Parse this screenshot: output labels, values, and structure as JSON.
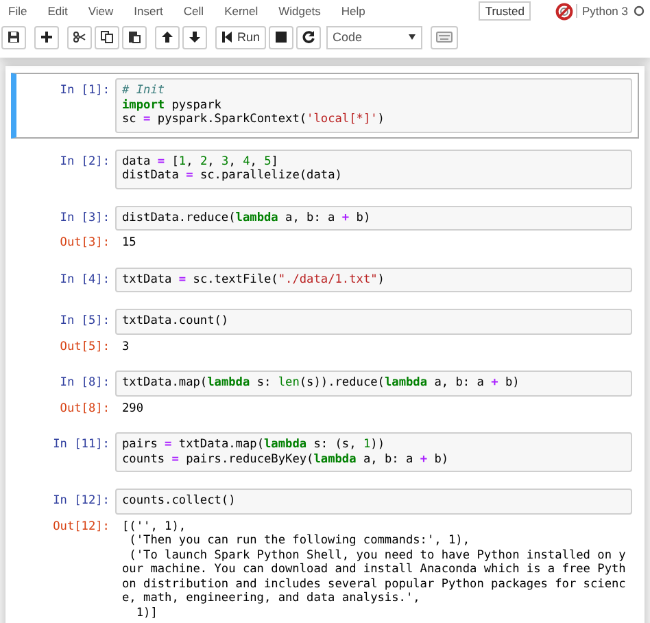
{
  "menu": [
    "File",
    "Edit",
    "View",
    "Insert",
    "Cell",
    "Kernel",
    "Widgets",
    "Help"
  ],
  "trusted": "Trusted",
  "kernel_name": "Python 3",
  "toolbar": [
    {
      "kind": "save"
    },
    {
      "kind": "sep"
    },
    {
      "kind": "add"
    },
    {
      "kind": "sep"
    },
    {
      "kind": "cut"
    },
    {
      "kind": "copy"
    },
    {
      "kind": "paste"
    },
    {
      "kind": "sep"
    },
    {
      "kind": "up"
    },
    {
      "kind": "down"
    },
    {
      "kind": "sep"
    },
    {
      "kind": "run",
      "label": "Run"
    },
    {
      "kind": "stop"
    },
    {
      "kind": "restart"
    },
    {
      "kind": "select",
      "label": "Code"
    },
    {
      "kind": "sep"
    },
    {
      "kind": "keyboard"
    }
  ],
  "cells": [
    {
      "prompt": "In [1]:",
      "selected": true,
      "lines": [
        [
          {
            "kind": "comment",
            "text": "# Init"
          }
        ],
        [
          {
            "kind": "keyword",
            "text": "import"
          },
          {
            "kind": "plain",
            "text": " pyspark"
          }
        ],
        [
          {
            "kind": "plain",
            "text": "sc "
          },
          {
            "kind": "operator",
            "text": "="
          },
          {
            "kind": "plain",
            "text": " pyspark.SparkContext("
          },
          {
            "kind": "string",
            "text": "'local[*]'"
          },
          {
            "kind": "plain",
            "text": ")"
          }
        ]
      ]
    },
    {
      "prompt": "In [2]:",
      "selected": false,
      "lines": [
        [
          {
            "kind": "plain",
            "text": "data "
          },
          {
            "kind": "operator",
            "text": "="
          },
          {
            "kind": "plain",
            "text": " ["
          },
          {
            "kind": "number",
            "text": "1"
          },
          {
            "kind": "plain",
            "text": ", "
          },
          {
            "kind": "number",
            "text": "2"
          },
          {
            "kind": "plain",
            "text": ", "
          },
          {
            "kind": "number",
            "text": "3"
          },
          {
            "kind": "plain",
            "text": ", "
          },
          {
            "kind": "number",
            "text": "4"
          },
          {
            "kind": "plain",
            "text": ", "
          },
          {
            "kind": "number",
            "text": "5"
          },
          {
            "kind": "plain",
            "text": "]"
          }
        ],
        [
          {
            "kind": "plain",
            "text": "distData "
          },
          {
            "kind": "operator",
            "text": "="
          },
          {
            "kind": "plain",
            "text": " sc.parallelize(data)"
          }
        ]
      ]
    },
    {
      "prompt": "In [3]:",
      "selected": false,
      "lines": [
        [
          {
            "kind": "plain",
            "text": "distData.reduce("
          },
          {
            "kind": "keyword",
            "text": "lambda"
          },
          {
            "kind": "plain",
            "text": " a, b: a "
          },
          {
            "kind": "operator",
            "text": "+"
          },
          {
            "kind": "plain",
            "text": " b)"
          }
        ]
      ],
      "output": {
        "prompt": "Out[3]:",
        "lines": [
          "15"
        ]
      }
    },
    {
      "prompt": "In [4]:",
      "selected": false,
      "lines": [
        [
          {
            "kind": "plain",
            "text": "txtData "
          },
          {
            "kind": "operator",
            "text": "="
          },
          {
            "kind": "plain",
            "text": " sc.textFile("
          },
          {
            "kind": "string",
            "text": "\"./data/1.txt\""
          },
          {
            "kind": "plain",
            "text": ")"
          }
        ]
      ]
    },
    {
      "prompt": "In [5]:",
      "selected": false,
      "lines": [
        [
          {
            "kind": "plain",
            "text": "txtData.count()"
          }
        ]
      ],
      "output": {
        "prompt": "Out[5]:",
        "lines": [
          "3"
        ]
      }
    },
    {
      "prompt": "In [8]:",
      "selected": false,
      "lines": [
        [
          {
            "kind": "plain",
            "text": "txtData.map("
          },
          {
            "kind": "keyword",
            "text": "lambda"
          },
          {
            "kind": "plain",
            "text": " s: "
          },
          {
            "kind": "builtin",
            "text": "len"
          },
          {
            "kind": "plain",
            "text": "(s)).reduce("
          },
          {
            "kind": "keyword",
            "text": "lambda"
          },
          {
            "kind": "plain",
            "text": " a, b: a "
          },
          {
            "kind": "operator",
            "text": "+"
          },
          {
            "kind": "plain",
            "text": " b)"
          }
        ]
      ],
      "output": {
        "prompt": "Out[8]:",
        "lines": [
          "290"
        ]
      }
    },
    {
      "prompt": "In [11]:",
      "selected": false,
      "lines": [
        [
          {
            "kind": "plain",
            "text": "pairs "
          },
          {
            "kind": "operator",
            "text": "="
          },
          {
            "kind": "plain",
            "text": " txtData.map("
          },
          {
            "kind": "keyword",
            "text": "lambda"
          },
          {
            "kind": "plain",
            "text": " s: (s, "
          },
          {
            "kind": "number",
            "text": "1"
          },
          {
            "kind": "plain",
            "text": "))"
          }
        ],
        [
          {
            "kind": "plain",
            "text": "counts "
          },
          {
            "kind": "operator",
            "text": "="
          },
          {
            "kind": "plain",
            "text": " pairs.reduceByKey("
          },
          {
            "kind": "keyword",
            "text": "lambda"
          },
          {
            "kind": "plain",
            "text": " a, b: a "
          },
          {
            "kind": "operator",
            "text": "+"
          },
          {
            "kind": "plain",
            "text": " b)"
          }
        ]
      ]
    },
    {
      "prompt": "In [12]:",
      "selected": false,
      "lines": [
        [
          {
            "kind": "plain",
            "text": "counts.collect()"
          }
        ]
      ],
      "output": {
        "prompt": "Out[12]:",
        "lines": [
          "[('', 1),",
          " ('Then you can run the following commands:', 1),",
          " ('To launch Spark Python Shell, you need to have Python installed on y",
          "our machine. You can download and install Anaconda which is a free Pyth",
          "on distribution and includes several popular Python packages for scienc",
          "e, math, engineering, and data analysis.',",
          "  1)]"
        ]
      }
    }
  ]
}
